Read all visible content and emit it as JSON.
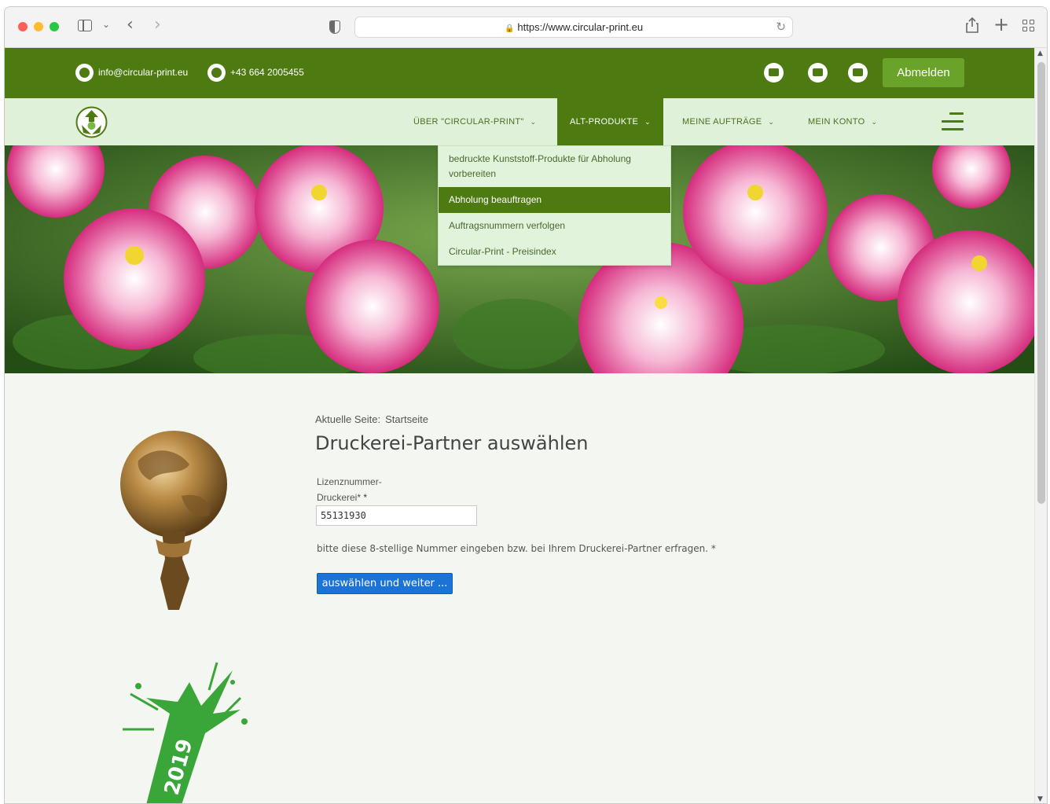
{
  "browser": {
    "url": "https://www.circular-print.eu"
  },
  "topbar": {
    "email": "info@circular-print.eu",
    "phone": "+43 664 2005455",
    "logout_label": "Abmelden"
  },
  "nav": {
    "items": [
      {
        "label": "ÜBER \"CIRCULAR-PRINT\""
      },
      {
        "label": "ALT-PRODUKTE"
      },
      {
        "label": "MEINE AUFTRÄGE"
      },
      {
        "label": "MEIN KONTO"
      }
    ],
    "dropdown": [
      {
        "label": "bedruckte Kunststoff-Produkte für Abholung vorbereiten"
      },
      {
        "label": "Abholung beauftragen"
      },
      {
        "label": "Auftragsnummern verfolgen"
      },
      {
        "label": "Circular-Print - Preisindex"
      }
    ]
  },
  "main": {
    "breadcrumb_label": "Aktuelle Seite:",
    "breadcrumb_current": "Startseite",
    "title": "Druckerei-Partner auswählen",
    "field_label_line1": "Lizenznummer-",
    "field_label_line2": "Druckerei*",
    "field_required": "*",
    "field_value": "55131930",
    "hint": "bitte diese 8-stellige Nummer eingeben bzw. bei Ihrem Druckerei-Partner erfragen. *",
    "submit_label": "auswählen und weiter ..."
  },
  "award": {
    "year": "2019"
  },
  "colors": {
    "brand_green": "#4d7b12",
    "nav_bg": "#dff1d9",
    "button_blue": "#1a73d6"
  }
}
